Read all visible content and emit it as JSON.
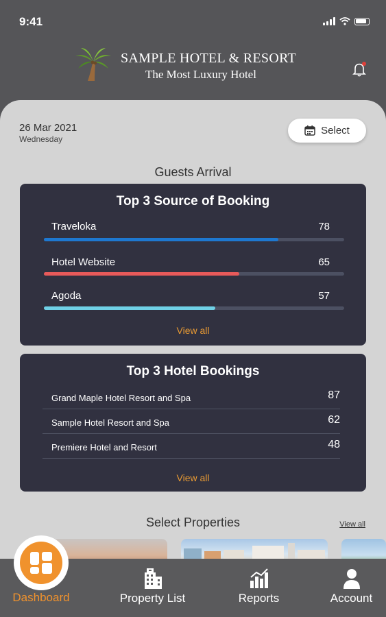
{
  "status": {
    "time": "9:41"
  },
  "header": {
    "name": "SAMPLE HOTEL & RESORT",
    "tagline": "The Most Luxury Hotel"
  },
  "date": {
    "main": "26 Mar 2021",
    "day": "Wednesday"
  },
  "select_button": {
    "label": "Select"
  },
  "guests_title": "Guests Arrival",
  "source_card": {
    "title": "Top 3 Source of Booking",
    "max": 100,
    "items": [
      {
        "label": "Traveloka",
        "value": "78",
        "color": "#1e78d0"
      },
      {
        "label": "Hotel Website",
        "value": "65",
        "color": "#e85a5a"
      },
      {
        "label": "Agoda",
        "value": "57",
        "color": "#6fd0e6"
      }
    ],
    "view_all": "View all"
  },
  "hotel_card": {
    "title": "Top 3 Hotel Bookings",
    "items": [
      {
        "label": "Grand Maple Hotel Resort and Spa",
        "value": "87"
      },
      {
        "label": "Sample Hotel Resort and Spa",
        "value": "62"
      },
      {
        "label": "Premiere Hotel and Resort",
        "value": "48"
      }
    ],
    "view_all": "View all"
  },
  "properties": {
    "title": "Select Properties",
    "view_all": "View all"
  },
  "nav": {
    "dashboard": "Dashboard",
    "property_list": "Property List",
    "reports": "Reports",
    "account": "Account"
  },
  "colors": {
    "accent": "#f0922d",
    "card": "#313140",
    "sheet": "#d4d4d4",
    "header": "#555558"
  }
}
